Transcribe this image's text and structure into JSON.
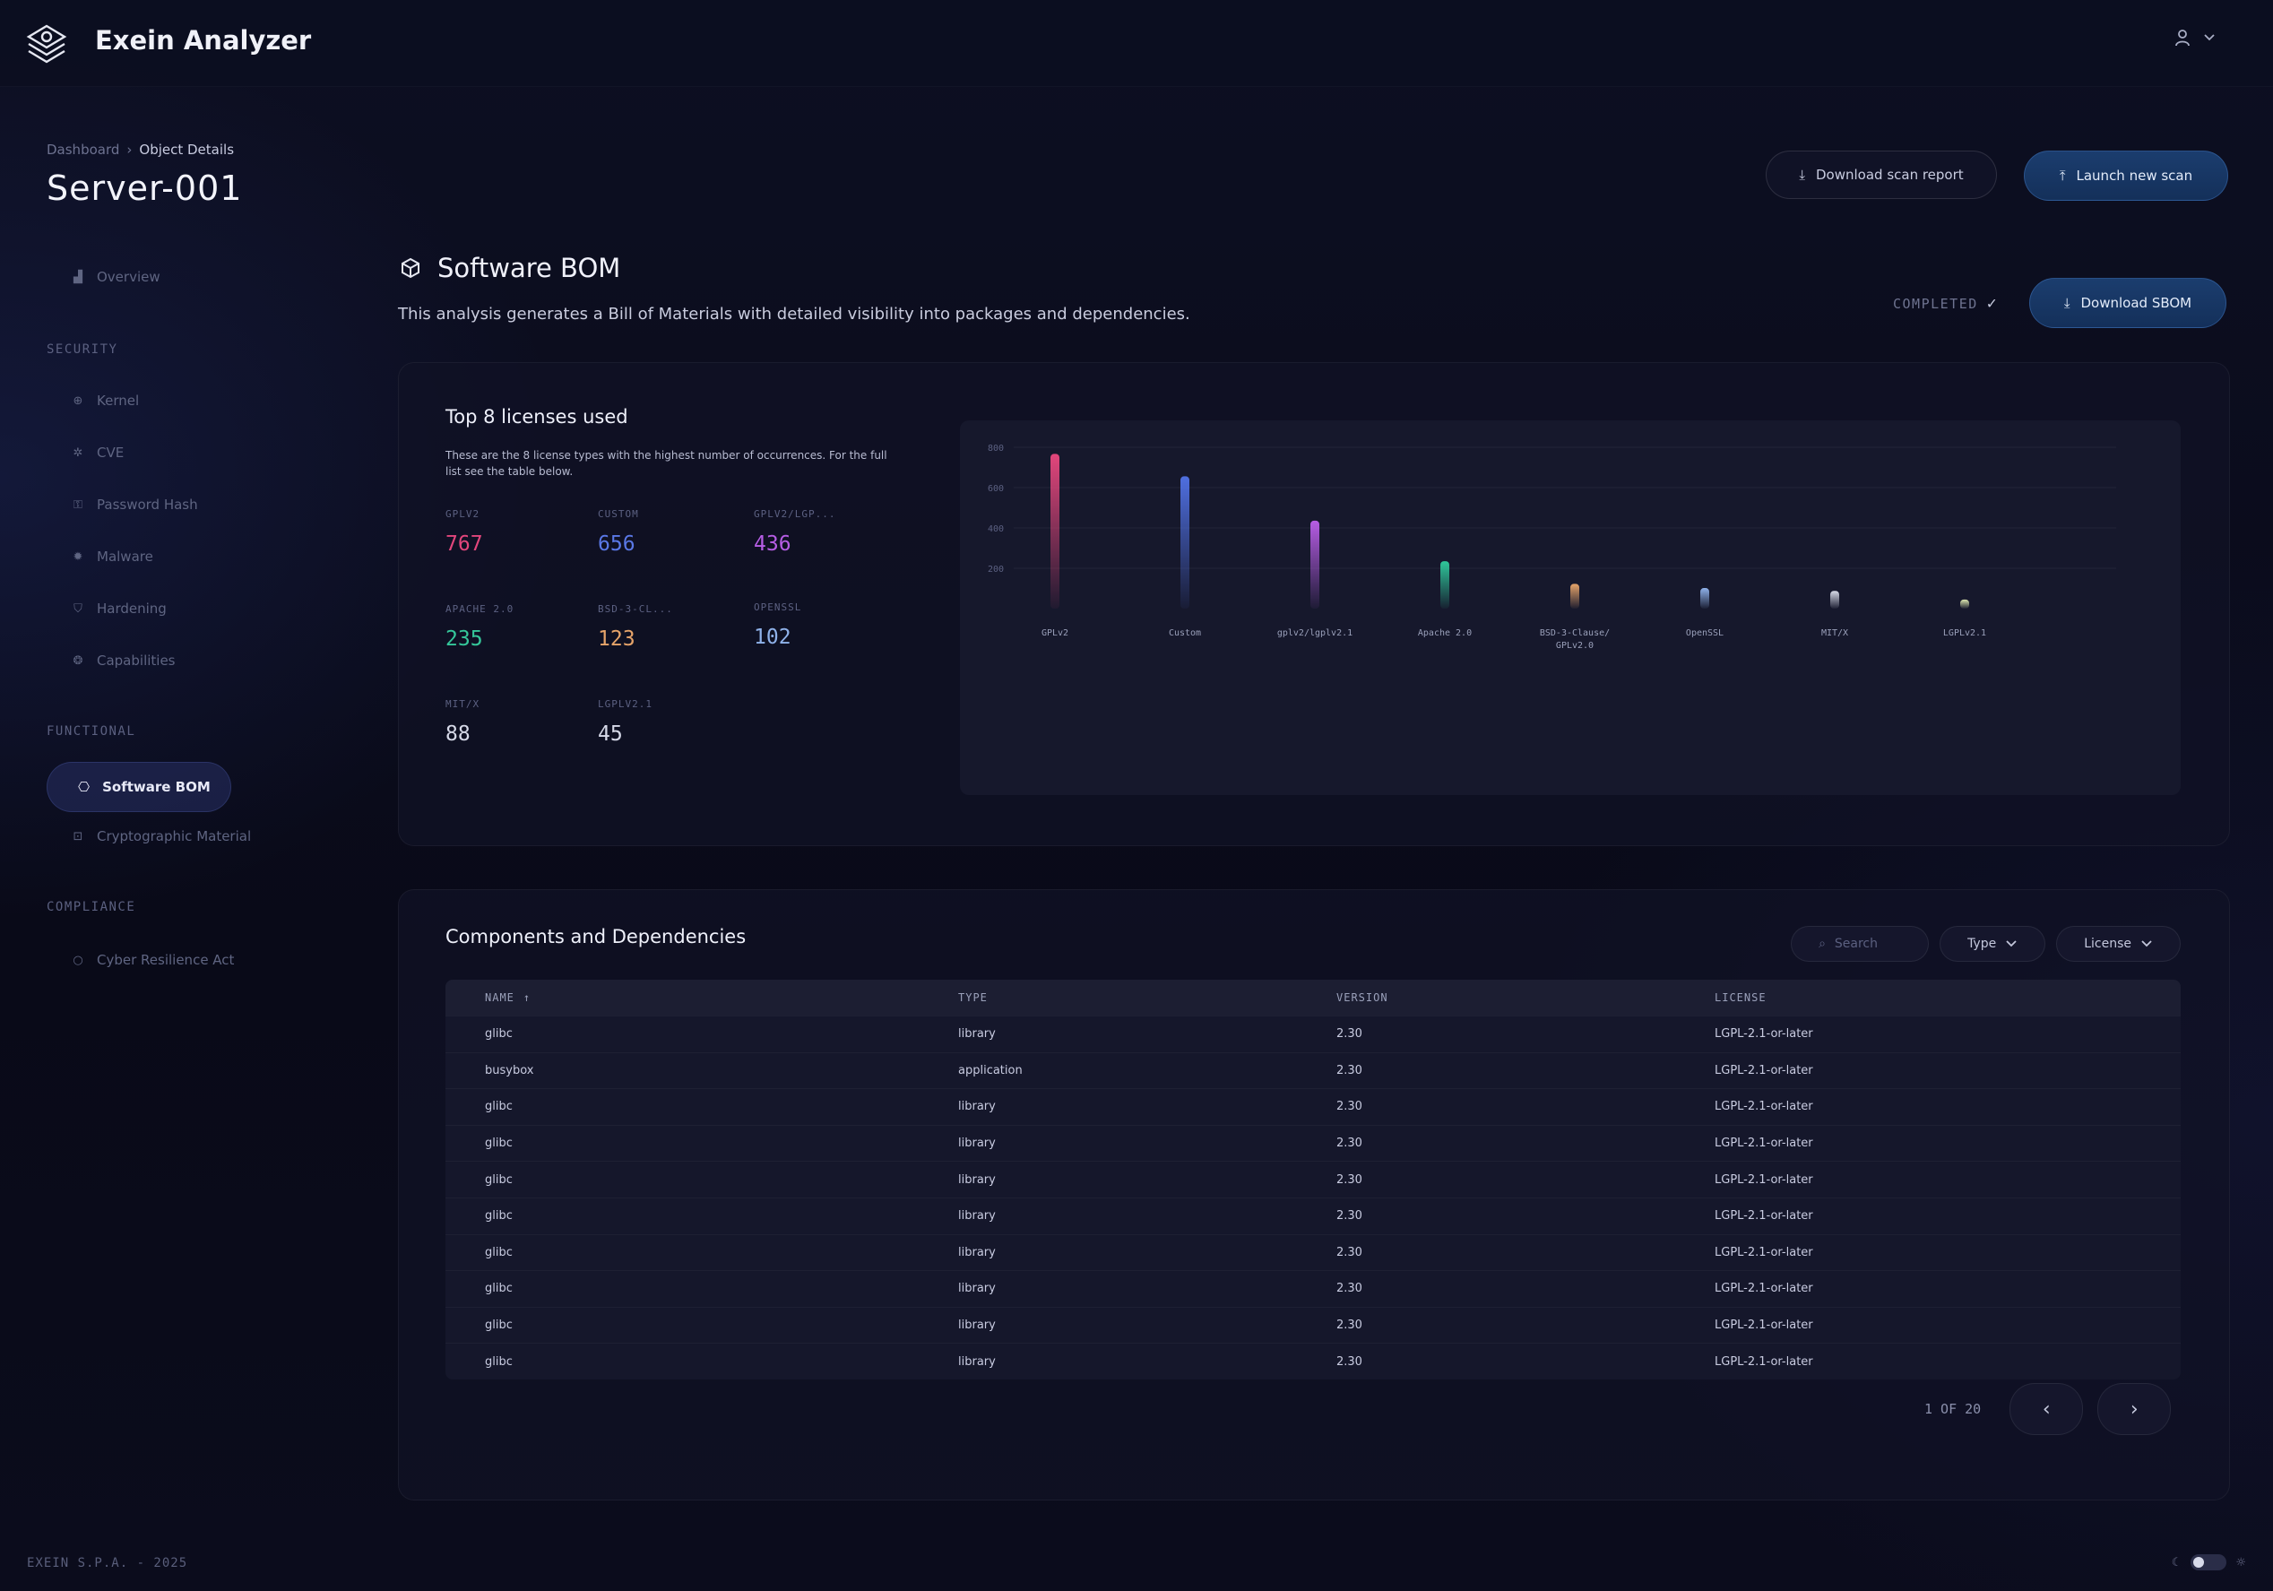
{
  "app": {
    "name": "Exein Analyzer",
    "user_icon": "user-icon"
  },
  "breadcrumb": {
    "root": "Dashboard",
    "current": "Object Details"
  },
  "page": {
    "title": "Server-001"
  },
  "header_actions": {
    "download_report": "Download scan report",
    "launch_scan": "Launch new scan"
  },
  "sidebar": {
    "overview": "Overview",
    "security_label": "SECURITY",
    "security_items": [
      "Kernel",
      "CVE",
      "Password Hash",
      "Malware",
      "Hardening",
      "Capabilities"
    ],
    "functional_label": "FUNCTIONAL",
    "functional_items": [
      "Software BOM",
      "Cryptographic Material"
    ],
    "compliance_label": "COMPLIANCE",
    "compliance_items": [
      "Cyber Resilience Act"
    ]
  },
  "section": {
    "title": "Software BOM",
    "description": "This analysis generates a Bill of Materials with detailed visibility into packages and dependencies.",
    "status": "COMPLETED",
    "download_sbom": "Download SBOM"
  },
  "licenses": {
    "title": "Top 8 licenses used",
    "description": "These are the 8 license types with the highest number of occurrences. For the full list see the table below.",
    "stats": [
      {
        "label": "GPLV2",
        "value": "767",
        "color": "#e2467c"
      },
      {
        "label": "CUSTOM",
        "value": "656",
        "color": "#5a78e6"
      },
      {
        "label": "GPLV2/LGP...",
        "value": "436",
        "color": "#b65de4"
      },
      {
        "label": "APACHE 2.0",
        "value": "235",
        "color": "#35c79a"
      },
      {
        "label": "BSD-3-CL...",
        "value": "123",
        "color": "#e6a46a"
      },
      {
        "label": "OPENSSL",
        "value": "102",
        "color": "#8fb2ea"
      },
      {
        "label": "MIT/X",
        "value": "88",
        "color": "#c9ccde"
      },
      {
        "label": "LGPLV2.1",
        "value": "45",
        "color": "#c9ccde"
      }
    ]
  },
  "chart_data": {
    "type": "bar",
    "categories": [
      "GPLv2",
      "Custom",
      "gplv2/lgplv2.1",
      "Apache 2.0",
      "BSD-3-Clause/ GPLv2.0",
      "OpenSSL",
      "MIT/X",
      "LGPLv2.1"
    ],
    "values": [
      767,
      656,
      436,
      235,
      123,
      102,
      88,
      45
    ],
    "colors": [
      "#e2467c",
      "#4f6fe0",
      "#b65de4",
      "#2fc79a",
      "#e6a46a",
      "#8fb2ea",
      "#d8dbe8",
      "#dce7b0"
    ],
    "ylim": [
      0,
      800
    ],
    "yticks": [
      "800",
      "600",
      "400",
      "200"
    ],
    "grid": true
  },
  "table": {
    "title": "Components and Dependencies",
    "search_placeholder": "Search",
    "filter_type": "Type",
    "filter_license": "License",
    "columns": [
      "NAME",
      "TYPE",
      "VERSION",
      "LICENSE"
    ],
    "rows": [
      [
        "glibc",
        "library",
        "2.30",
        "LGPL-2.1-or-later"
      ],
      [
        "busybox",
        "application",
        "2.30",
        "LGPL-2.1-or-later"
      ],
      [
        "glibc",
        "library",
        "2.30",
        "LGPL-2.1-or-later"
      ],
      [
        "glibc",
        "library",
        "2.30",
        "LGPL-2.1-or-later"
      ],
      [
        "glibc",
        "library",
        "2.30",
        "LGPL-2.1-or-later"
      ],
      [
        "glibc",
        "library",
        "2.30",
        "LGPL-2.1-or-later"
      ],
      [
        "glibc",
        "library",
        "2.30",
        "LGPL-2.1-or-later"
      ],
      [
        "glibc",
        "library",
        "2.30",
        "LGPL-2.1-or-later"
      ],
      [
        "glibc",
        "library",
        "2.30",
        "LGPL-2.1-or-later"
      ],
      [
        "glibc",
        "library",
        "2.30",
        "LGPL-2.1-or-later"
      ]
    ],
    "pagination": "1 OF 20"
  },
  "footer": {
    "text": "EXEIN S.P.A. - 2025"
  }
}
